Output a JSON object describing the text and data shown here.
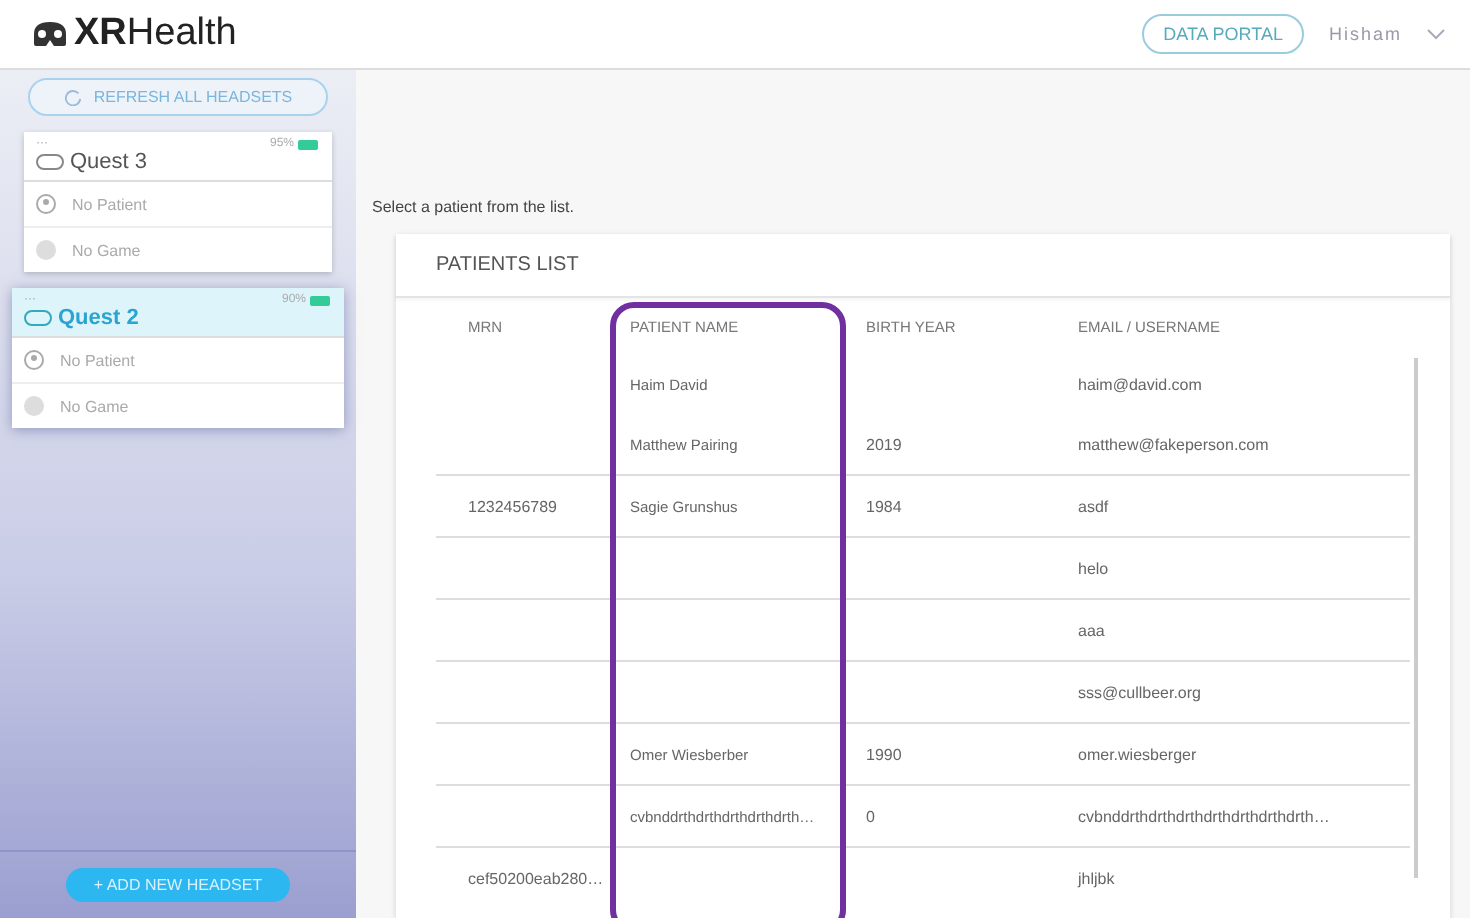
{
  "header": {
    "logo": "XRHealth",
    "portal_button": "DATA PORTAL",
    "user": "Hisham"
  },
  "sidebar": {
    "refresh_button": "REFRESH ALL HEADSETS",
    "add_button": "+ ADD NEW HEADSET",
    "headsets": [
      {
        "menu": "···",
        "name": "Quest 3",
        "battery": "95%",
        "patient": "No Patient",
        "game": "No Game",
        "selected": false
      },
      {
        "menu": "···",
        "name": "Quest 2",
        "battery": "90%",
        "patient": "No Patient",
        "game": "No Game",
        "selected": true
      }
    ]
  },
  "main": {
    "instruction": "Select a patient from the list.",
    "list_title": "PATIENTS LIST",
    "columns": [
      {
        "label": "MRN",
        "highlighted": false
      },
      {
        "label": "PATIENT NAME",
        "highlighted": true
      },
      {
        "label": "BIRTH YEAR",
        "highlighted": false
      },
      {
        "label": "EMAIL / USERNAME",
        "highlighted": false
      }
    ],
    "rows": [
      [
        "",
        "Haim David",
        "",
        "haim@david.com"
      ],
      [
        "",
        "Matthew Pairing",
        "2019",
        "matthew@fakeperson.com"
      ],
      [
        "1232456789",
        "Sagie Grunshus",
        "1984",
        "asdf"
      ],
      [
        "",
        "",
        "",
        "helo"
      ],
      [
        "",
        "",
        "",
        "aaa"
      ],
      [
        "",
        "",
        "",
        "sss@cullbeer.org"
      ],
      [
        "",
        "Omer Wiesberber",
        "1990",
        "omer.wiesberger"
      ],
      [
        "",
        "cvbnddrthdrthdrthdrthdrth…",
        "0",
        "cvbnddrthdrthdrthdrthdrthdrthdrth…"
      ],
      [
        "cef50200eab280…",
        "",
        "",
        "jhljbk"
      ]
    ]
  }
}
